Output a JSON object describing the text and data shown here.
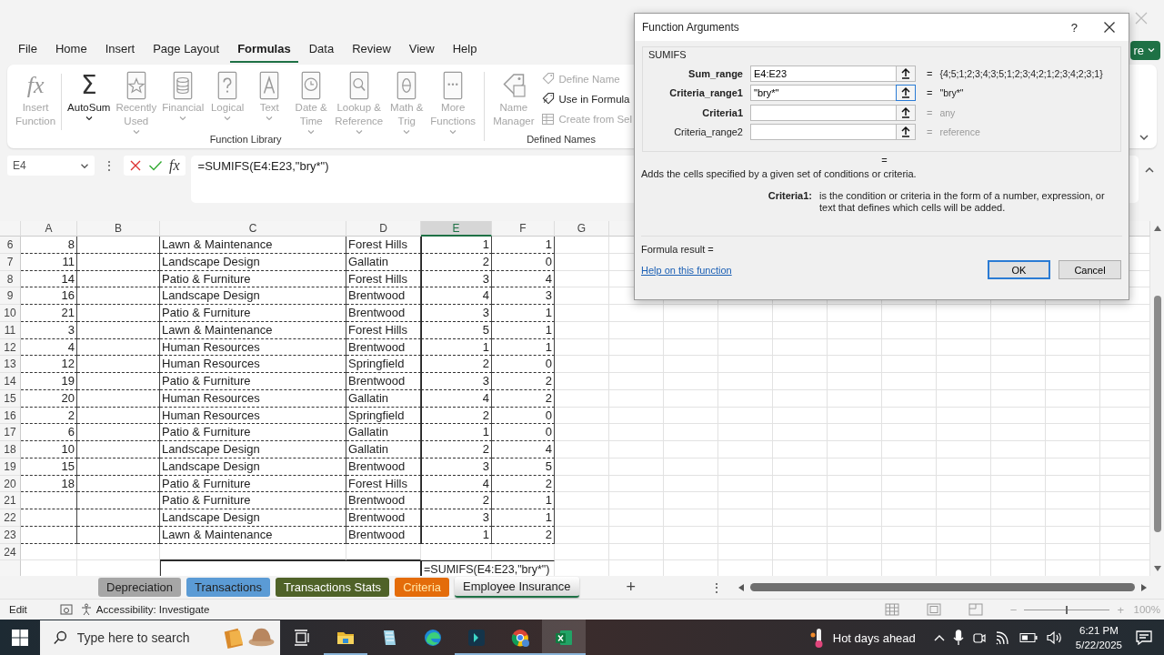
{
  "ribbon_tabs": [
    {
      "label": "File",
      "selected": false
    },
    {
      "label": "Home",
      "selected": false
    },
    {
      "label": "Insert",
      "selected": false
    },
    {
      "label": "Page Layout",
      "selected": false
    },
    {
      "label": "Formulas",
      "selected": true
    },
    {
      "label": "Data",
      "selected": false
    },
    {
      "label": "Review",
      "selected": false
    },
    {
      "label": "View",
      "selected": false
    },
    {
      "label": "Help",
      "selected": false
    }
  ],
  "share_button": {
    "label": "re"
  },
  "ribbon_groups": [
    {
      "label": "Function Library",
      "buttons": [
        {
          "kind": "large",
          "glyph": "fx",
          "lines": [
            "Insert",
            "Function"
          ],
          "disabled": true,
          "caret": false
        },
        {
          "kind": "large",
          "glyph": "Σ",
          "lines": [
            "AutoSum"
          ],
          "disabled": false,
          "caret": true
        },
        {
          "kind": "large",
          "lines": [
            "Recently",
            "Used"
          ],
          "disabled": true,
          "caret": true
        },
        {
          "kind": "large",
          "lines": [
            "Financial"
          ],
          "disabled": true,
          "caret": true
        },
        {
          "kind": "large",
          "lines": [
            "Logical"
          ],
          "disabled": true,
          "caret": true
        },
        {
          "kind": "large",
          "lines": [
            "Text"
          ],
          "disabled": true,
          "caret": true
        },
        {
          "kind": "large",
          "lines": [
            "Date &",
            "Time"
          ],
          "disabled": true,
          "caret": true
        },
        {
          "kind": "large",
          "lines": [
            "Lookup &",
            "Reference"
          ],
          "disabled": true,
          "caret": true
        },
        {
          "kind": "large",
          "lines": [
            "Math &",
            "Trig"
          ],
          "disabled": true,
          "caret": true
        },
        {
          "kind": "large",
          "lines": [
            "More",
            "Functions"
          ],
          "disabled": true,
          "caret": true
        }
      ]
    },
    {
      "label": "Defined Names",
      "buttons": [
        {
          "kind": "large",
          "lines": [
            "Name",
            "Manager"
          ],
          "disabled": true,
          "caret": false
        },
        {
          "kind": "stack",
          "items": [
            {
              "label": "Define Name",
              "disabled": true
            },
            {
              "label": "Use in Formula",
              "disabled": false
            },
            {
              "label": "Create from Sel",
              "disabled": true
            }
          ]
        }
      ]
    }
  ],
  "formula_bar": {
    "name_box": "E4",
    "more_glyph": "⋮",
    "fx_glyph": "fx",
    "formula": "=SUMIFS(E4:E23,\"bry*\")"
  },
  "sheet": {
    "columns": [
      {
        "label": "A",
        "selected": false
      },
      {
        "label": "B",
        "selected": false
      },
      {
        "label": "C",
        "selected": false
      },
      {
        "label": "D",
        "selected": false
      },
      {
        "label": "E",
        "selected": true
      },
      {
        "label": "F",
        "selected": false
      },
      {
        "label": "G",
        "selected": false
      }
    ],
    "rows": [
      {
        "kind": "data",
        "number": "6",
        "a": "8",
        "c": "Lawn & Maintenance",
        "d": "Forest Hills",
        "e": "1",
        "f": "1"
      },
      {
        "kind": "data",
        "number": "7",
        "a": "11",
        "c": "Landscape Design",
        "d": "Gallatin",
        "e": "2",
        "f": "0"
      },
      {
        "kind": "data",
        "number": "8",
        "a": "14",
        "c": "Patio & Furniture",
        "d": "Forest Hills",
        "e": "3",
        "f": "4"
      },
      {
        "kind": "data",
        "number": "9",
        "a": "16",
        "c": "Landscape Design",
        "d": "Brentwood",
        "e": "4",
        "f": "3"
      },
      {
        "kind": "data",
        "number": "10",
        "a": "21",
        "c": "Patio & Furniture",
        "d": "Brentwood",
        "e": "3",
        "f": "1"
      },
      {
        "kind": "data",
        "number": "11",
        "a": "3",
        "c": "Lawn & Maintenance",
        "d": "Forest Hills",
        "e": "5",
        "f": "1"
      },
      {
        "kind": "data",
        "number": "12",
        "a": "4",
        "c": "Human Resources",
        "d": "Brentwood",
        "e": "1",
        "f": "1"
      },
      {
        "kind": "data",
        "number": "13",
        "a": "12",
        "c": "Human Resources",
        "d": "Springfield",
        "e": "2",
        "f": "0"
      },
      {
        "kind": "data",
        "number": "14",
        "a": "19",
        "c": "Patio & Furniture",
        "d": "Brentwood",
        "e": "3",
        "f": "2"
      },
      {
        "kind": "data",
        "number": "15",
        "a": "20",
        "c": "Human Resources",
        "d": "Gallatin",
        "e": "4",
        "f": "2"
      },
      {
        "kind": "data",
        "number": "16",
        "a": "2",
        "c": "Human Resources",
        "d": "Springfield",
        "e": "2",
        "f": "0"
      },
      {
        "kind": "data",
        "number": "17",
        "a": "6",
        "c": "Patio & Furniture",
        "d": "Gallatin",
        "e": "1",
        "f": "0"
      },
      {
        "kind": "data",
        "number": "18",
        "a": "10",
        "c": "Landscape Design",
        "d": "Gallatin",
        "e": "2",
        "f": "4"
      },
      {
        "kind": "data",
        "number": "19",
        "a": "15",
        "c": "Landscape Design",
        "d": "Brentwood",
        "e": "3",
        "f": "5"
      },
      {
        "kind": "data",
        "number": "20",
        "a": "18",
        "c": "Patio & Furniture",
        "d": "Forest Hills",
        "e": "4",
        "f": "2"
      },
      {
        "kind": "data",
        "number": "21",
        "c": "Patio & Furniture",
        "d": "Brentwood",
        "e": "2",
        "f": "1"
      },
      {
        "kind": "data",
        "number": "22",
        "c": "Landscape Design",
        "d": "Brentwood",
        "e": "3",
        "f": "1"
      },
      {
        "kind": "data",
        "number": "23",
        "c": "Lawn & Maintenance",
        "d": "Brentwood",
        "e": "1",
        "f": "2"
      },
      {
        "kind": "blank",
        "number": "24"
      },
      {
        "kind": "formula",
        "formula": "=SUMIFS(E4:E23,\"bry*\")"
      }
    ]
  },
  "sheet_tabs": [
    {
      "label": "Depreciation",
      "color": "#a6a6a6",
      "selected": false
    },
    {
      "label": "Transactions",
      "color": "#5b9bd5",
      "selected": false
    },
    {
      "label": "Transactions Stats",
      "color": "#4f6228",
      "selected": false
    },
    {
      "label": "Criteria",
      "color": "#e46c0a",
      "selected": false
    },
    {
      "label": "Employee Insurance",
      "color": "#d9d9d9",
      "selected": true
    }
  ],
  "add_sheet_glyph": "+",
  "tabs_menu_glyph": "⋮",
  "status_bar": {
    "mode": "Edit",
    "accessibility": "Accessibility: Investigate",
    "zoom": {
      "minus": "−",
      "plus": "+",
      "level": 0.5,
      "reading": "100%"
    }
  },
  "dialog": {
    "title": "Function Arguments",
    "help_glyph": "?",
    "function": "SUMIFS",
    "arguments": [
      {
        "label": "Sum_range",
        "required": true,
        "value": "E4:E23",
        "focused": false,
        "sign": "=",
        "result": "{4;5;1;2;3;4;3;5;1;2;3;4;2;1;2;3;4;2;3;1}",
        "muted": false
      },
      {
        "label": "Criteria_range1",
        "required": true,
        "value": "\"bry*\"",
        "focused": true,
        "sign": "=",
        "result": "\"bry*\"",
        "muted": false
      },
      {
        "label": "Criteria1",
        "required": true,
        "focused": false,
        "sign": "=",
        "result": "any",
        "muted": true
      },
      {
        "label": "Criteria_range2",
        "required": false,
        "focused": false,
        "sign": "=",
        "result": "reference",
        "muted": true
      }
    ],
    "function_result_sign": "=",
    "description": "Adds the cells specified by a given set of conditions or criteria.",
    "argument_help": {
      "label": "Criteria1:",
      "text": "is the condition or criteria in the form of a number, expression, or text that defines which cells will be added."
    },
    "formula_result": "Formula result =",
    "help_link": "Help on this function",
    "buttons": [
      {
        "label": "OK",
        "default": true
      },
      {
        "label": "Cancel",
        "default": false
      }
    ]
  },
  "taskbar": {
    "search_placeholder": "Type here to search",
    "apps": [
      {
        "running": false,
        "active": false
      },
      {
        "running": true,
        "active": false
      },
      {
        "running": false,
        "active": false
      },
      {
        "running": false,
        "active": false
      },
      {
        "running": true,
        "active": false
      },
      {
        "running": true,
        "active": false
      },
      {
        "running": true,
        "active": true
      }
    ],
    "weather": "Hot days ahead",
    "time": "6:21 PM",
    "date": "5/22/2025"
  }
}
